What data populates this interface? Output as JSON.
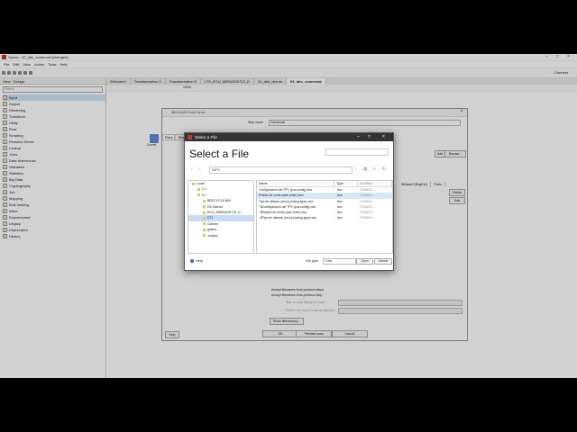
{
  "app": {
    "title": "Spoon - 02_dim_comercial (changed)",
    "menu": [
      "File",
      "Edit",
      "View",
      "Action",
      "Tools",
      "Help"
    ],
    "connect_label": "Connect"
  },
  "left_panel": {
    "tabs": [
      "View",
      "Design"
    ],
    "search_placeholder": "Search",
    "tree": [
      "Input",
      "Output",
      "Streaming",
      "Transform",
      "Utility",
      "Flow",
      "Scripting",
      "Pentaho Server",
      "Lookup",
      "Joins",
      "Data Warehouse",
      "Validation",
      "Statistics",
      "Big Data",
      "Cryptography",
      "Job",
      "Mapping",
      "Bulk loading",
      "Inline",
      "Experimental",
      "Legacy",
      "Deprecated",
      "History"
    ]
  },
  "editor_tabs": [
    "Welcome!",
    "Transformation 1",
    "Transformation 3",
    "LTS_ECU_MIRAGO0712_D",
    "01_dim_cliente",
    "02_dim_comercial"
  ],
  "zoom": "100%",
  "canvas_step_label": "Comer",
  "input_dialog": {
    "title": "Microsoft Excel input",
    "step_name_label": "Step name",
    "step_name_value": "Comercial",
    "tabs": [
      "Files",
      "Shee"
    ],
    "add_button": "Add",
    "browse_button": "Browse...",
    "grid_headers": [
      "Wildcard (RegExp)",
      "Exclu"
    ],
    "delete_button": "Delete",
    "edit_button": "Edit",
    "accept_filenames": "Accept filenames from previous steps",
    "accept_filenames2": "Accept filenames from previous step",
    "step_to_read": "Step to read filenames from",
    "field_in_input": "Field in the input to use as filename",
    "show_filenames": "Show filename(s)...",
    "help_button": "Help",
    "ok_button": "OK",
    "preview_button": "Preview rows",
    "cancel_button": "Cancel"
  },
  "file_dialog": {
    "window_title": "Select a File",
    "heading": "Select a File",
    "filter_value": "",
    "path": "\\\\APV",
    "tree": [
      {
        "label": "Local",
        "selected": false
      },
      {
        "label": "C:\\",
        "selected": false
      },
      {
        "label": "D:\\",
        "selected": false
      },
      {
        "label": "$RECYCLE.BIN",
        "selected": false
      },
      {
        "label": "EA Games",
        "selected": false
      },
      {
        "label": "ECU_MIRAGO0712_D",
        "selected": false
      },
      {
        "label": "ETL",
        "selected": true
      },
      {
        "label": "Games",
        "selected": false
      },
      {
        "label": "grafos",
        "selected": false
      },
      {
        "label": "Juegos",
        "selected": false
      }
    ],
    "columns": [
      "Name",
      "Type",
      "Modified"
    ],
    "files": [
      {
        "name": "Configuración del TPV (pos.config).xlsx",
        "type": "xlsx",
        "modified": "07/06/24 ...",
        "selected": false
      },
      {
        "name": "Pedido de venta (sale.order).xlsx",
        "type": "xlsx",
        "modified": "07/06/24 ...",
        "selected": true
      },
      {
        "name": "Tipo de albarán (stock.picking.type).xlsx",
        "type": "xlsx",
        "modified": "07/06/24 ...",
        "selected": false
      },
      {
        "name": "~$Configuración del TPV (pos.config).xlsx",
        "type": "xlsx",
        "modified": "07/06/24 ...",
        "selected": false
      },
      {
        "name": "~$Pedido de venta (sale.order).xlsx",
        "type": "xlsx",
        "modified": "07/06/24 ...",
        "selected": false
      },
      {
        "name": "~$Tipo de albarán (stock.picking.type).xlsx",
        "type": "xlsx",
        "modified": "07/06/24 ...",
        "selected": false
      }
    ],
    "help_label": "Help",
    "file_type_label": "File type:",
    "file_type_value": "*.xlsx",
    "open_button": "Open",
    "cancel_button": "Cancel"
  }
}
